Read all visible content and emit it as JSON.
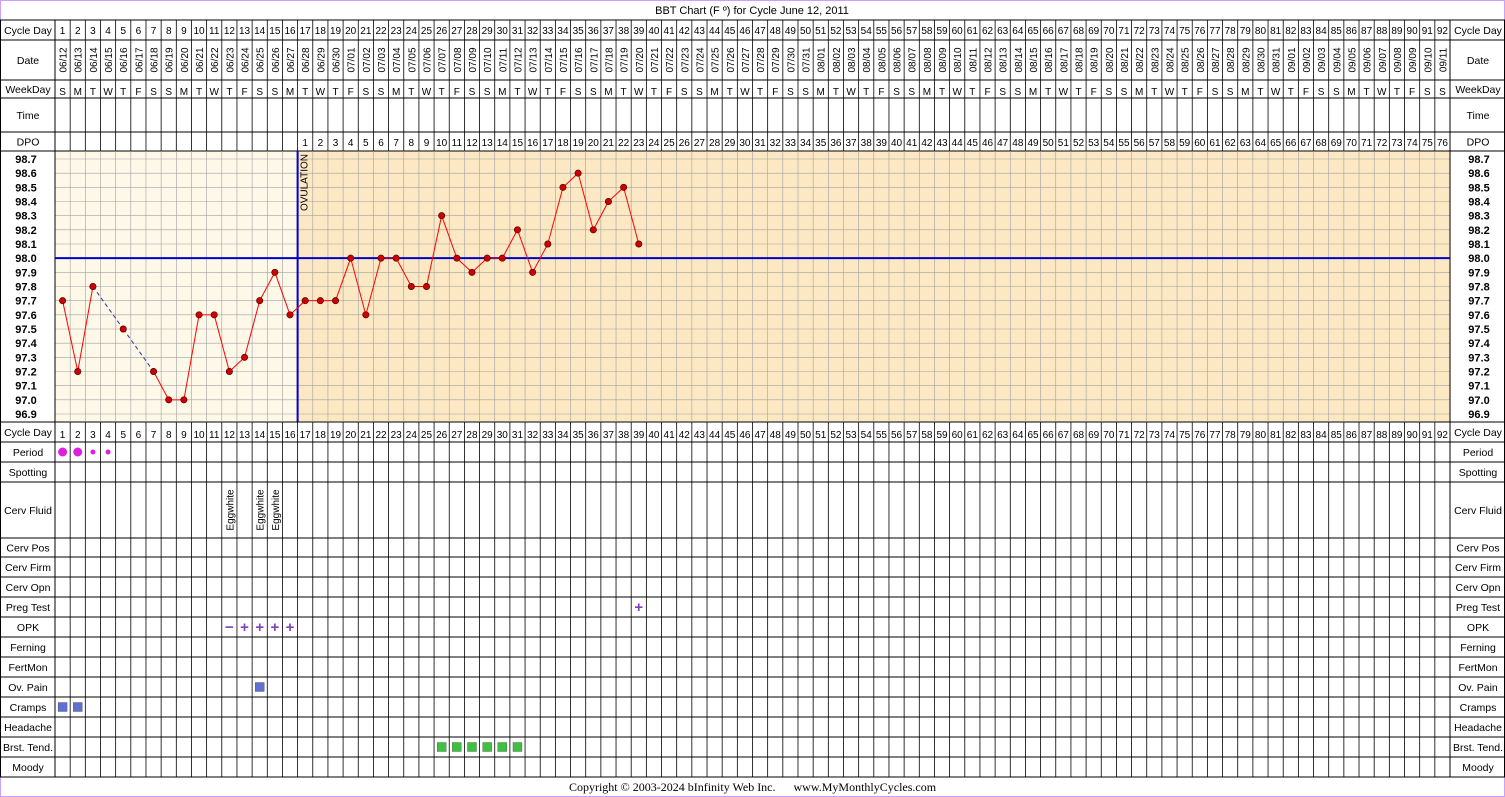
{
  "title": "BBT Chart (F º) for Cycle June 12, 2011",
  "footer": {
    "copyright": "Copyright © 2003-2024 bInfinity Web Inc.",
    "site": "www.MyMonthlyCycles.com"
  },
  "row_labels": {
    "cycle_day": "Cycle Day",
    "date": "Date",
    "weekday": "WeekDay",
    "time": "Time",
    "dpo": "DPO",
    "period": "Period",
    "spotting": "Spotting",
    "cerv_fluid": "Cerv Fluid",
    "cerv_pos": "Cerv Pos",
    "cerv_firm": "Cerv Firm",
    "cerv_opn": "Cerv Opn",
    "preg_test": "Preg Test",
    "opk": "OPK",
    "ferning": "Ferning",
    "fertmon": "FertMon",
    "ov_pain": "Ov. Pain",
    "cramps": "Cramps",
    "headache": "Headache",
    "brst_tend": "Brst. Tend.",
    "moody": "Moody"
  },
  "ovulation_label": "OVULATION",
  "colors": {
    "follicular_bg": "#fdf8e8",
    "luteal_bg": "#fde8c4",
    "grid": "#a0a0a0",
    "coverline": "#0000cc",
    "temp_line": "#ff0000",
    "temp_point": "#cc0000",
    "period": "#e020e0",
    "opk": "#8040c0",
    "ov_pain": "#6070d0",
    "brst_tend": "#40c040",
    "border": "#c8a0ff"
  },
  "chart_data": {
    "type": "line",
    "title": "BBT Chart (F º) for Cycle June 12, 2011",
    "xlabel": "Cycle Day",
    "ylabel": "",
    "ylim": [
      96.9,
      98.7
    ],
    "y_ticks": [
      "98.7",
      "98.6",
      "98.5",
      "98.4",
      "98.3",
      "98.2",
      "98.1",
      "98.0",
      "97.9",
      "97.8",
      "97.7",
      "97.6",
      "97.5",
      "97.4",
      "97.3",
      "97.2",
      "97.1",
      "97.0",
      "96.9"
    ],
    "num_days": 92,
    "dates": [
      "06/12",
      "06/13",
      "06/14",
      "06/15",
      "06/16",
      "06/17",
      "06/18",
      "06/19",
      "06/20",
      "06/21",
      "06/22",
      "06/23",
      "06/24",
      "06/25",
      "06/26",
      "06/27",
      "06/28",
      "06/29",
      "06/30",
      "07/01",
      "07/02",
      "07/03",
      "07/04",
      "07/05",
      "07/06",
      "07/07",
      "07/08",
      "07/09",
      "07/10",
      "07/11",
      "07/12",
      "07/13",
      "07/14",
      "07/15",
      "07/16",
      "07/17",
      "07/18",
      "07/19",
      "07/20",
      "07/21",
      "07/22",
      "07/23",
      "07/24",
      "07/25",
      "07/26",
      "07/27",
      "07/28",
      "07/29",
      "07/30",
      "07/31",
      "08/01",
      "08/02",
      "08/03",
      "08/04",
      "08/05",
      "08/06",
      "08/07",
      "08/08",
      "08/09",
      "08/10",
      "08/11",
      "08/12",
      "08/13",
      "08/14",
      "08/15",
      "08/16",
      "08/17",
      "08/18",
      "08/19",
      "08/20",
      "08/21",
      "08/22",
      "08/23",
      "08/24",
      "08/25",
      "08/26",
      "08/27",
      "08/28",
      "08/29",
      "08/30",
      "08/31",
      "09/01",
      "09/02",
      "09/03",
      "09/04",
      "09/05",
      "09/06",
      "09/07",
      "09/08",
      "09/09",
      "09/10",
      "09/11"
    ],
    "weekdays": [
      "S",
      "M",
      "T",
      "W",
      "T",
      "F",
      "S",
      "S",
      "M",
      "T",
      "W",
      "T",
      "F",
      "S",
      "S",
      "M",
      "T",
      "W",
      "T",
      "F",
      "S",
      "S",
      "M",
      "T",
      "W",
      "T",
      "F",
      "S",
      "S",
      "M",
      "T",
      "W",
      "T",
      "F",
      "S",
      "S",
      "M",
      "T",
      "W",
      "T",
      "F",
      "S",
      "S",
      "M",
      "T",
      "W",
      "T",
      "F",
      "S",
      "S",
      "M",
      "T",
      "W",
      "T",
      "F",
      "S",
      "S",
      "M",
      "T",
      "W",
      "T",
      "F",
      "S",
      "S",
      "M",
      "T",
      "W",
      "T",
      "F",
      "S",
      "S",
      "M",
      "T",
      "W",
      "T",
      "F",
      "S",
      "S",
      "M",
      "T",
      "W",
      "T",
      "F",
      "S",
      "S",
      "M",
      "T",
      "W",
      "T",
      "F",
      "S",
      "S"
    ],
    "dpo_start_day": 17,
    "dpo_max": 76,
    "ovulation_day": 16,
    "coverline": 98.0,
    "series": [
      {
        "days": [
          1,
          2,
          3,
          5,
          7,
          8,
          9,
          10,
          11,
          12,
          13,
          14,
          15,
          16,
          17,
          18,
          19,
          20,
          21,
          22,
          23,
          24,
          25,
          26,
          27,
          28,
          29,
          30,
          31,
          32,
          33,
          34,
          35,
          36,
          37,
          38,
          39
        ],
        "temps": [
          97.7,
          97.2,
          97.8,
          97.5,
          97.2,
          97.0,
          97.0,
          97.6,
          97.6,
          97.2,
          97.3,
          97.7,
          97.9,
          97.6,
          97.7,
          97.7,
          97.7,
          98.0,
          97.6,
          98.0,
          98.0,
          97.8,
          97.8,
          98.3,
          98.0,
          97.9,
          98.0,
          98.0,
          98.2,
          97.9,
          98.1,
          98.5,
          98.6,
          98.2,
          98.4,
          98.5,
          98.1
        ]
      }
    ],
    "gap_days": [
      [
        3,
        5
      ],
      [
        5,
        7
      ]
    ],
    "period": [
      {
        "day": 1,
        "size": "large"
      },
      {
        "day": 2,
        "size": "large"
      },
      {
        "day": 3,
        "size": "small"
      },
      {
        "day": 4,
        "size": "small"
      }
    ],
    "cerv_fluid": [
      {
        "day": 12,
        "label": "Eggwhite"
      },
      {
        "day": 14,
        "label": "Eggwhite"
      },
      {
        "day": 15,
        "label": "Eggwhite"
      }
    ],
    "preg_test": [
      {
        "day": 39,
        "result": "+"
      }
    ],
    "opk": [
      {
        "day": 12,
        "result": "−"
      },
      {
        "day": 13,
        "result": "+"
      },
      {
        "day": 14,
        "result": "+"
      },
      {
        "day": 15,
        "result": "+"
      },
      {
        "day": 16,
        "result": "+"
      }
    ],
    "ov_pain": [
      14
    ],
    "cramps": [
      1,
      2
    ],
    "brst_tend": [
      26,
      27,
      28,
      29,
      30,
      31
    ]
  }
}
